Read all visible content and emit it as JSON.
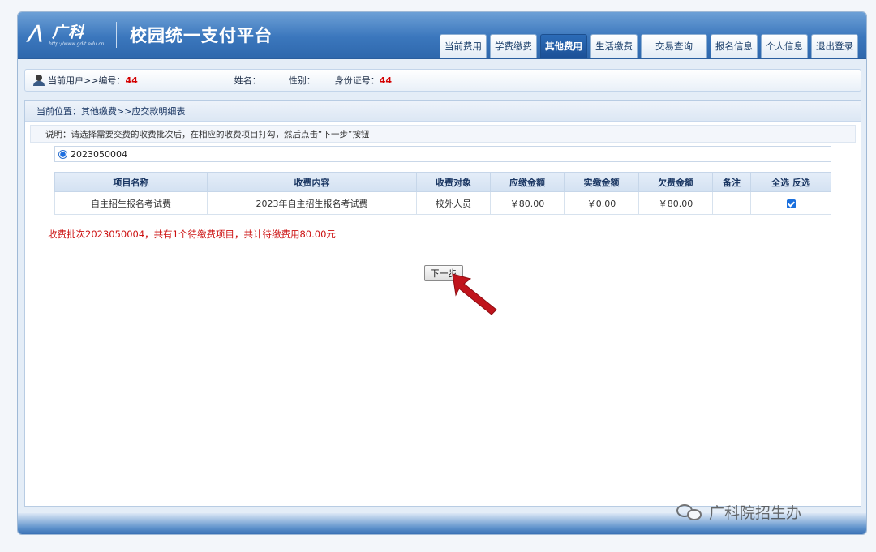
{
  "app": {
    "logo_text": "广科",
    "logo_url": "http://www.gdlt.edu.cn",
    "title": "校园统一支付平台"
  },
  "nav": [
    {
      "label": "当前费用",
      "active": false
    },
    {
      "label": "学费缴费",
      "active": false
    },
    {
      "label": "其他费用",
      "active": true
    },
    {
      "label": "生活缴费",
      "active": false
    },
    {
      "label": "交易查询",
      "active": false
    },
    {
      "label": "报名信息",
      "active": false
    },
    {
      "label": "个人信息",
      "active": false
    },
    {
      "label": "退出登录",
      "active": false
    }
  ],
  "user": {
    "label": "当前用户>>编号：",
    "id_value": "44",
    "name_label": "姓名：",
    "gender_label": "性别：",
    "idcard_label": "身份证号：",
    "idcard_value": "44"
  },
  "breadcrumb": "当前位置：其他缴费>>应交款明细表",
  "note": "说明：请选择需要交费的收费批次后，在相应的收费项目打勾，然后点击“下一步”按钮",
  "batch": {
    "value": "2023050004",
    "selected": true
  },
  "table": {
    "headers": [
      "项目名称",
      "收费内容",
      "收费对象",
      "应缴金额",
      "实缴金额",
      "欠费金额",
      "备注",
      "全选 反选"
    ],
    "rows": [
      {
        "item_name": "自主招生报名考试费",
        "content": "2023年自主招生报名考试费",
        "target": "校外人员",
        "due": "￥80.00",
        "paid": "￥0.00",
        "owed": "￥80.00",
        "remark": "",
        "checked": true
      }
    ]
  },
  "summary": "收费批次2023050004，共有1个待缴费项目，共计待缴费用80.00元",
  "next_button": "下一步",
  "watermark": "广科院招生办",
  "colors": {
    "header_blue": "#3b77bd",
    "active_tab": "#1c5197",
    "alert_red": "#cc1111",
    "arrow_red": "#c0141c"
  }
}
